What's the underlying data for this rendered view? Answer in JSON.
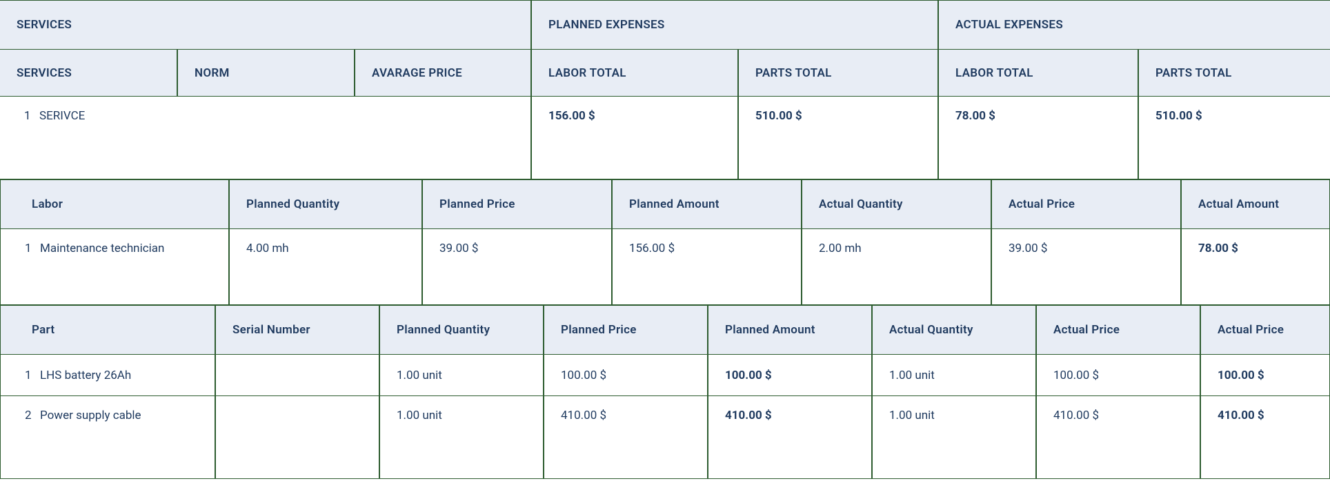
{
  "top": {
    "services": "SERVICES",
    "planned": "PLANNED EXPENSES",
    "actual": "ACTUAL EXPENSES",
    "sub": {
      "services": "SERVICES",
      "norm": "NORM",
      "avg": "AVARAGE PRICE",
      "labor_total": "LABOR TOTAL",
      "parts_total": "PARTS TOTAL",
      "labor_total_a": "LABOR TOTAL",
      "parts_total_a": "PARTS TOTAL"
    }
  },
  "service_row": {
    "idx": "1",
    "name": "SERIVCE",
    "planned_labor": "156.00 $",
    "planned_parts": "510.00 $",
    "actual_labor": "78.00 $",
    "actual_parts": "510.00 $"
  },
  "labor": {
    "headers": {
      "labor": "Labor",
      "pq": "Planned Quantity",
      "pp": "Planned Price",
      "pa": "Planned Amount",
      "aq": "Actual Quantity",
      "ap": "Actual Price",
      "aa": "Actual Amount"
    },
    "row": {
      "idx": "1",
      "name": "Maintenance technician",
      "pq": "4.00 mh",
      "pp": "39.00 $",
      "pa": "156.00 $",
      "aq": "2.00 mh",
      "ap": "39.00 $",
      "aa": "78.00 $"
    }
  },
  "parts": {
    "headers": {
      "part": "Part",
      "sn": "Serial Number",
      "pq": "Planned Quantity",
      "pp": "Planned Price",
      "pa": "Planned Amount",
      "aq": "Actual Quantity",
      "ap": "Actual Price",
      "aa": "Actual Price"
    },
    "rows": [
      {
        "idx": "1",
        "name": "LHS battery 26Ah",
        "sn": "",
        "pq": "1.00 unit",
        "pp": "100.00  $",
        "pa": "100.00  $",
        "aq": "1.00 unit",
        "ap": "100.00  $",
        "aa": "100.00  $"
      },
      {
        "idx": "2",
        "name": "Power supply cable",
        "sn": "",
        "pq": "1.00 unit",
        "pp": "410.00 $",
        "pa": "410.00  $",
        "aq": "1.00 unit",
        "ap": "410.00 $",
        "aa": "410.00 $"
      }
    ]
  }
}
